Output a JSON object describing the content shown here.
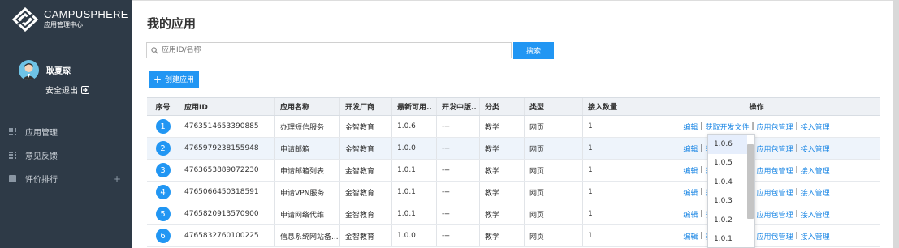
{
  "app": {
    "title": "CAMPUSPHERE",
    "subtitle": "应用管理中心"
  },
  "user": {
    "name": "耿夏琛",
    "logout_label": "安全退出"
  },
  "menu": [
    {
      "label": "应用管理",
      "icon": "grid-icon"
    },
    {
      "label": "意见反馈",
      "icon": "grid-icon"
    },
    {
      "label": "评价排行",
      "icon": "chart-icon",
      "expandable": "+"
    }
  ],
  "page": {
    "title": "我的应用"
  },
  "search": {
    "placeholder": "应用ID/名称",
    "button_label": "搜索"
  },
  "create_button_label": "创建应用",
  "table": {
    "headers": [
      "序号",
      "应用ID",
      "应用名称",
      "开发厂商",
      "最新可用..",
      "开发中版..",
      "分类",
      "类型",
      "接入数量",
      "操作"
    ],
    "rows": [
      {
        "no": "1",
        "id": "4763514653390885",
        "name": "办理短信服务",
        "vendor": "金智教育",
        "latest": "1.0.6",
        "dev": "---",
        "category": "教学",
        "type": "网页",
        "count": "1"
      },
      {
        "no": "2",
        "id": "4765979238155948",
        "name": "申请邮箱",
        "vendor": "金智教育",
        "latest": "1.0.0",
        "dev": "---",
        "category": "教学",
        "type": "网页",
        "count": "1"
      },
      {
        "no": "3",
        "id": "4763653889072230",
        "name": "申请邮箱列表",
        "vendor": "金智教育",
        "latest": "1.0.1",
        "dev": "---",
        "category": "教学",
        "type": "网页",
        "count": "1"
      },
      {
        "no": "4",
        "id": "4765066450318591",
        "name": "申请VPN服务",
        "vendor": "金智教育",
        "latest": "1.0.1",
        "dev": "---",
        "category": "教学",
        "type": "网页",
        "count": "1"
      },
      {
        "no": "5",
        "id": "4765820913570900",
        "name": "申请网络代维",
        "vendor": "金智教育",
        "latest": "1.0.1",
        "dev": "---",
        "category": "教学",
        "type": "网页",
        "count": "1"
      },
      {
        "no": "6",
        "id": "4765832760100225",
        "name": "信息系统网站备...",
        "vendor": "金智教育",
        "latest": "1.0.0",
        "dev": "---",
        "category": "教学",
        "type": "网页",
        "count": "1"
      }
    ],
    "ops": {
      "edit": "编辑",
      "get_dev_file": "获取开发文件",
      "pkg_manage": "应用包管理",
      "access_manage": "接入管理",
      "sep": "|"
    }
  },
  "version_dropdown": {
    "options": [
      "1.0.6",
      "1.0.5",
      "1.0.4",
      "1.0.3",
      "1.0.2",
      "1.0.1"
    ],
    "selected": "1.0.6"
  },
  "colors": {
    "sidebar_bg": "#2e3a47",
    "accent": "#2196f3",
    "link": "#1e88e5"
  }
}
